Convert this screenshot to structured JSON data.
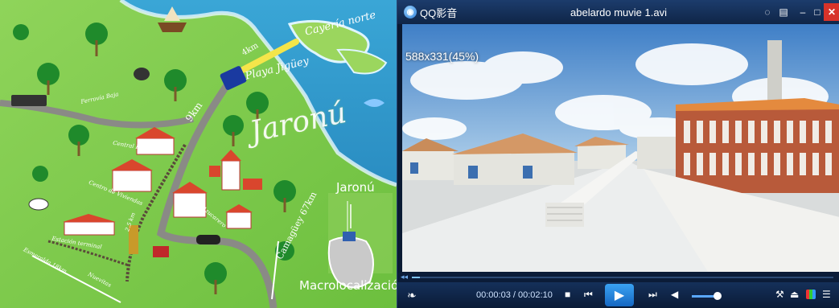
{
  "map": {
    "title": "Jaronú",
    "label_cayeria": "Cayería norte",
    "label_playa": "Playa Jigüey",
    "label_9km": "9km",
    "label_4km": "4km",
    "label_camaguey": "Camagüey 67km",
    "inset_town": "Jaronú",
    "inset_caption": "Macrolocalización",
    "small_labels": {
      "m1": "Ferrovía Baja",
      "m2": "Central Brasil",
      "m3": "Centro de Viviendas",
      "m4": "2.5 km",
      "m5": "Barrio Azucarero",
      "m6": "Estación terminal",
      "m7": "Esmeralda 18km",
      "m8": "Nuevitas"
    }
  },
  "player": {
    "app_name": "QQ影音",
    "video_title": "abelardo muvie 1.avi",
    "video_info": "588x331(45%)",
    "time_current": "00:00:03",
    "time_total": "00:02:10",
    "time_separator": " / ",
    "seek_progress": 0.02,
    "volume_level": 0.8,
    "colors": {
      "titlebar": "#1c3c6c",
      "accent": "#2a8ae6",
      "close": "#d7332a"
    },
    "icons": {
      "logo": "qq-player-logo-icon",
      "bubble": "chat-bubble-icon",
      "settings": "settings-icon",
      "minimize": "minimize-icon",
      "maximize": "maximize-icon",
      "close": "close-icon",
      "feet": "footprint-icon",
      "stop": "stop-icon",
      "prev": "previous-icon",
      "play": "play-icon",
      "next": "next-icon",
      "volume": "volume-icon",
      "tools": "tools-icon",
      "eject": "eject-icon",
      "colors": "color-adjust-icon",
      "playlist": "playlist-icon"
    }
  }
}
